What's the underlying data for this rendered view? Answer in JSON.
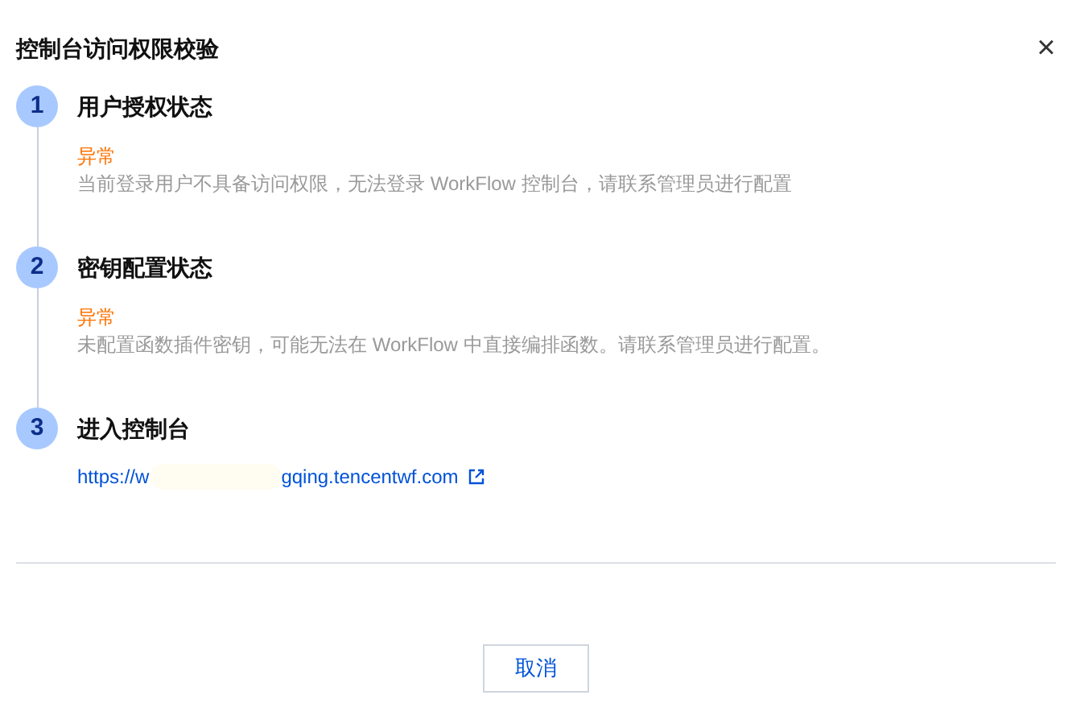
{
  "dialog": {
    "title": "控制台访问权限校验",
    "close": "×"
  },
  "steps": [
    {
      "number": "1",
      "title": "用户授权状态",
      "kind": "status",
      "status": "异常",
      "description": "当前登录用户不具备访问权限，无法登录 WorkFlow 控制台，请联系管理员进行配置"
    },
    {
      "number": "2",
      "title": "密钥配置状态",
      "kind": "status",
      "status": "异常",
      "description": "未配置函数插件密钥，可能无法在 WorkFlow 中直接编排函数。请联系管理员进行配置。"
    },
    {
      "number": "3",
      "title": "进入控制台",
      "kind": "link",
      "link_start": "https://w",
      "link_end": "gqing.tencentwf.com"
    }
  ],
  "buttons": [
    {
      "label": "取消"
    }
  ]
}
